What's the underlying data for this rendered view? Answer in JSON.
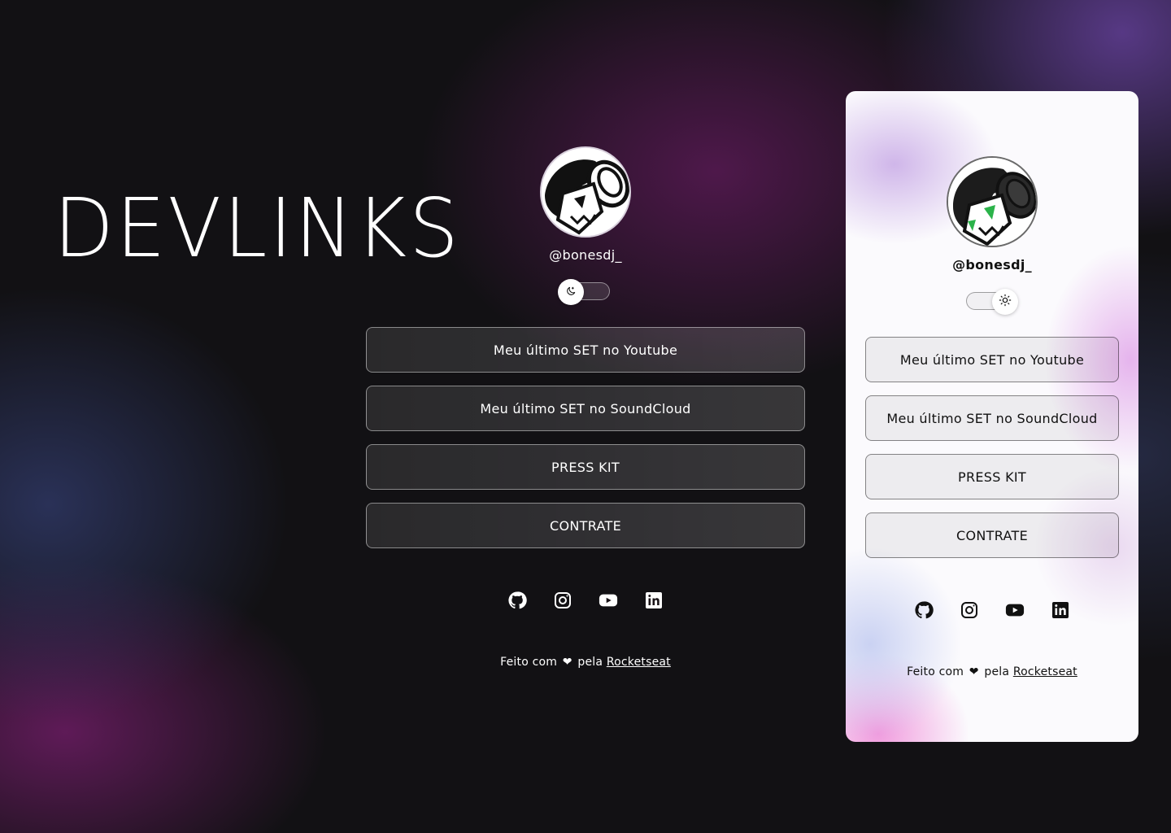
{
  "brand": {
    "title": "DEVLINKS"
  },
  "profile": {
    "handle": "@bonesdj_",
    "avatar_icon": "cat-with-headphones-avatar"
  },
  "links": [
    {
      "label": "Meu último SET no Youtube"
    },
    {
      "label": "Meu último SET no SoundCloud"
    },
    {
      "label": "PRESS KIT"
    },
    {
      "label": "CONTRATE"
    }
  ],
  "socials": [
    {
      "icon": "github-icon"
    },
    {
      "icon": "instagram-icon"
    },
    {
      "icon": "youtube-icon"
    },
    {
      "icon": "linkedin-icon"
    }
  ],
  "footer": {
    "prefix": "Feito com",
    "heart": "❤",
    "middle": "pela",
    "link": "Rocketseat"
  },
  "themes": {
    "dark": {
      "toggle_icon": "moon-icon",
      "accent": "#7a2a80"
    },
    "light": {
      "toggle_icon": "sun-icon",
      "accent": "#e9a6e8"
    }
  }
}
